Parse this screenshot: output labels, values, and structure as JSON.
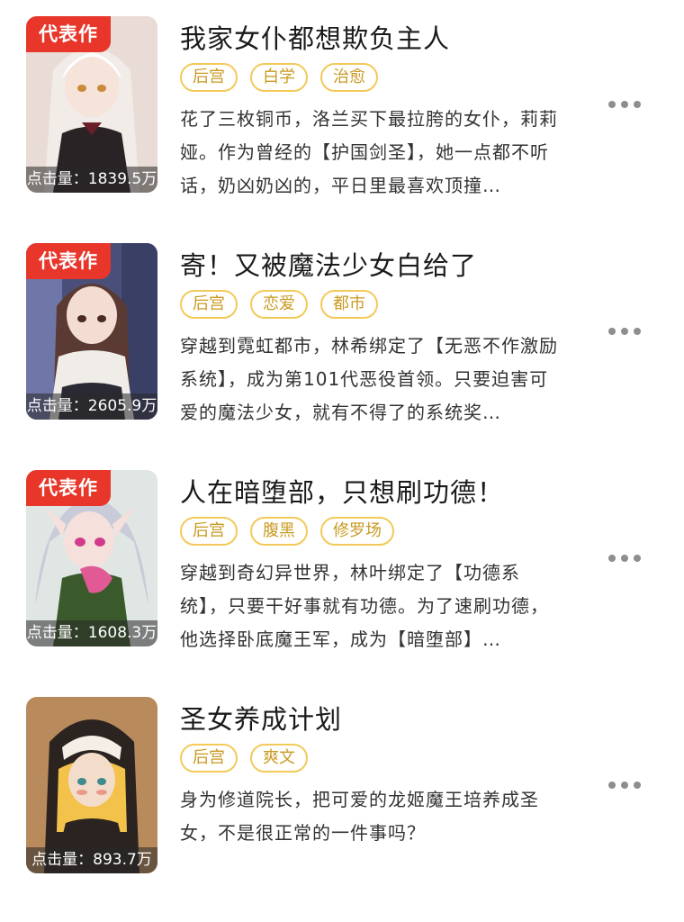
{
  "books": [
    {
      "badge": "代表作",
      "clicks": "点击量：1839.5万",
      "title": "我家女仆都想欺负主人",
      "tags": [
        "后宫",
        "白学",
        "治愈"
      ],
      "desc": "花了三枚铜币，洛兰买下最拉胯的女仆，莉莉娅。作为曾经的【护国剑圣】，她一点都不听话，奶凶奶凶的，平日里最喜欢顶撞…",
      "cover_icon": "maid-girl-cover",
      "colors": {
        "bg": "#e9dcd6",
        "hair": "#f1ece8",
        "accent": "#6b1f2a"
      }
    },
    {
      "badge": "代表作",
      "clicks": "点击量：2605.9万",
      "title": "寄！又被魔法少女白给了",
      "tags": [
        "后宫",
        "恋爱",
        "都市"
      ],
      "desc": "穿越到霓虹都市，林希绑定了【无恶不作激励系统】，成为第101代恶役首领。只要迫害可爱的魔法少女，就有不得了的系统奖…",
      "cover_icon": "office-girl-cover",
      "colors": {
        "bg": "#4a4f7a",
        "hair": "#5a3a32",
        "accent": "#f0ece8"
      }
    },
    {
      "badge": "代表作",
      "clicks": "点击量：1608.3万",
      "title": "人在暗堕部，只想刷功德！",
      "tags": [
        "后宫",
        "腹黑",
        "修罗场"
      ],
      "desc": "穿越到奇幻异世界，林叶绑定了【功德系统】，只要干好事就有功德。为了速刷功德，他选择卧底魔王军，成为【暗堕部】…",
      "cover_icon": "elf-girl-cover",
      "colors": {
        "bg": "#dfe6e4",
        "hair": "#c9ccd8",
        "accent": "#3b5a2c"
      }
    },
    {
      "badge": "",
      "clicks": "点击量：893.7万",
      "title": "圣女养成计划",
      "tags": [
        "后宫",
        "爽文"
      ],
      "desc": "身为修道院长，把可爱的龙姬魔王培养成圣女，不是很正常的一件事吗？",
      "cover_icon": "nun-girl-cover",
      "colors": {
        "bg": "#b88a5c",
        "hair": "#f2c24a",
        "accent": "#2a2320"
      }
    }
  ],
  "more_icon": "more-dots-icon"
}
